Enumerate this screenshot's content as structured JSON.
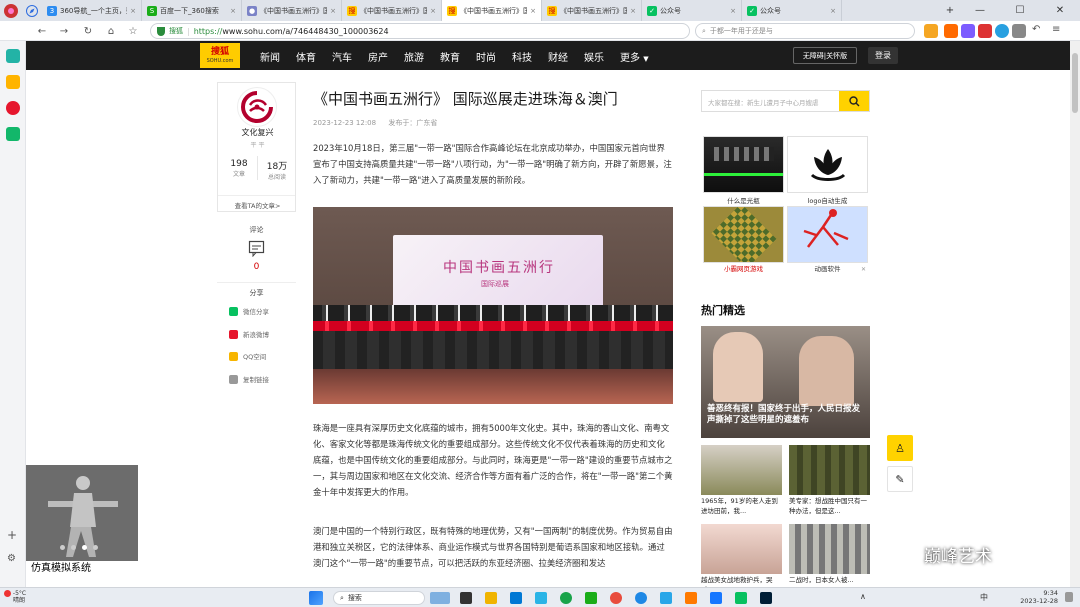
{
  "browser": {
    "tabs": [
      {
        "label": "360导航_一个主页，整个世界",
        "icon": "360-browser-icon",
        "color": "#2d8cf0",
        "active": false
      },
      {
        "label": "百度一下_360搜索",
        "icon": "360-search-icon",
        "color": "#1aad19",
        "active": false
      },
      {
        "label": "《中国书画五洲行》国际",
        "icon": "page-icon",
        "color": "#7b83c7",
        "active": false
      },
      {
        "label": "《中国书画五洲行》国际",
        "icon": "sohu-icon",
        "color": "#ffcc00",
        "active": false
      },
      {
        "label": "《中国书画五洲行》国际",
        "icon": "sohu-icon",
        "color": "#ffcc00",
        "active": true
      },
      {
        "label": "《中国书画五洲行》国际",
        "icon": "sohu-icon",
        "color": "#ffcc00",
        "active": false
      },
      {
        "label": "公众号",
        "icon": "wechat-icon",
        "color": "#07c160",
        "active": false
      },
      {
        "label": "公众号",
        "icon": "wechat-icon",
        "color": "#07c160",
        "active": false
      }
    ],
    "address": {
      "safe_label": "搜狐",
      "protocol": "https://",
      "host": "www.sohu.com/a/746448430_100003624"
    },
    "search_placeholder": "于都一年用于还是与"
  },
  "site": {
    "logo_main": "搜狐",
    "logo_sub": "SOHU.com",
    "nav": [
      "新闻",
      "体育",
      "汽车",
      "房产",
      "旅游",
      "教育",
      "时尚",
      "科技",
      "财经",
      "娱乐",
      "更多"
    ],
    "accessible_label": "无障碍|关怀版",
    "login_label": "登录"
  },
  "author": {
    "name": "文化复兴",
    "tag": "平 平",
    "articles_count": "198",
    "articles_label": "文章",
    "reads_count": "18万",
    "reads_label": "总阅读",
    "view_more": "查看TA的文章>"
  },
  "comments": {
    "label": "评论",
    "count": "0"
  },
  "share": {
    "label": "分享",
    "items": [
      {
        "label": "微信分享",
        "color": "#07c160"
      },
      {
        "label": "新浪微博",
        "color": "#e6162d"
      },
      {
        "label": "QQ空间",
        "color": "#f7b500"
      },
      {
        "label": "复制链接",
        "color": "#999999"
      }
    ]
  },
  "article": {
    "title": "《中国书画五洲行》 国际巡展走进珠海＆澳门",
    "date": "2023-12-23 12:08",
    "publisher": "发布于：广东省",
    "paragraphs": [
      "2023年10月18日，第三届\"一带一路\"国际合作高峰论坛在北京成功举办，中国国家元首向世界宣布了中国支持高质量共建\"一带一路\"八项行动，为\"一带一路\"明确了新方向，开辟了新愿景，注入了新动力，共建\"一带一路\"进入了高质量发展的新阶段。",
      "珠海是一座具有深厚历史文化底蕴的城市，拥有5000年文化史。其中，珠海的香山文化、南粤文化、客家文化等都是珠海传统文化的重要组成部分。这些传统文化不仅代表着珠海的历史和文化底蕴，也是中国传统文化的重要组成部分。与此同时，珠海更是\"一带一路\"建设的重要节点城市之一，其与周边国家和地区在文化交流、经济合作等方面有着广泛的合作，将在\"一带一路\"第二个黄金十年中发挥更大的作用。",
      "澳门是中国的一个特别行政区，既有特殊的地理优势，又有\"一国两制\"的制度优势。作为贸易自由港和独立关税区，它的法律体系、商业运作模式与世界各国特别是葡语系国家和地区接轨。通过澳门这个\"一带一路\"的重要节点，可以把活跃的东亚经济圈、拉美经济圈和发达"
    ],
    "photo_banner": "中国书画五洲行",
    "photo_banner_sub": "国际巡展"
  },
  "sidebar": {
    "search_placeholder": "大家都在搜：新生儿遭月子中心月嫂虐",
    "ads": [
      {
        "caption": "什么是光瓶"
      },
      {
        "caption": "logo自动生成"
      },
      {
        "caption": "小霸网页游戏"
      },
      {
        "caption": "动画软件"
      }
    ],
    "hot_title": "热门精选",
    "hot_main_caption": "善恶终有报！国家终于出手，人民日报发声撕掉了这些明星的遮羞布",
    "hot_items": [
      {
        "caption": "1965年，91岁的老人走到进坊田前，我..."
      },
      {
        "caption": "美专家：想战胜中国只有一种办法，但是这..."
      },
      {
        "caption": "越战美女战地救护兵，哭喊..."
      },
      {
        "caption": "二战时，日本女人被..."
      }
    ]
  },
  "overlay": {
    "watermark": "巅峰艺术",
    "model_caption": "仿真模拟系统"
  },
  "taskbar": {
    "weather_temp": "-5°C",
    "weather_desc": "晴朗",
    "search_label": "搜索",
    "time": "9:34",
    "date": "2023-12-28",
    "ime": "中"
  }
}
